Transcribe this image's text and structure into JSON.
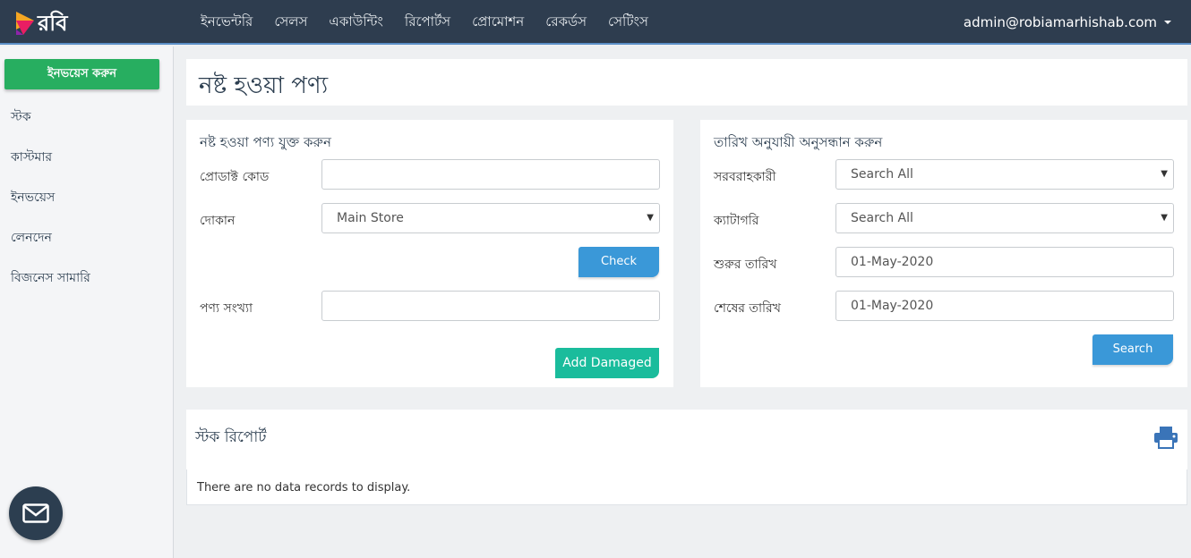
{
  "brand": {
    "name": "রবি"
  },
  "nav": {
    "items": [
      "ইনভেন্টরি",
      "সেলস",
      "একাউন্টিং",
      "রিপোর্টস",
      "প্রোমোশন",
      "রেকর্ডস",
      "সেটিংস"
    ],
    "user": "admin@robiamarhishab.com"
  },
  "sidebar": {
    "invoice_button": "ইনভয়েস করুন",
    "items": [
      "স্টক",
      "কাস্টমার",
      "ইনভয়েস",
      "লেনদেন",
      "বিজনেস সামারি"
    ]
  },
  "page": {
    "title": "নষ্ট হওয়া পণ্য"
  },
  "add_form": {
    "heading": "নষ্ট হওয়া পণ্য যুক্ত করুন",
    "product_code_label": "প্রোডাক্ট কোড",
    "product_code_value": "",
    "store_label": "দোকান",
    "store_value": "Main Store",
    "check_button": "Check",
    "quantity_label": "পণ্য সংখ্যা",
    "quantity_value": "",
    "add_button": "Add Damaged"
  },
  "search_form": {
    "heading": "তারিখ অনুযায়ী অনুসন্ধান করুন",
    "supplier_label": "সরবরাহকারী",
    "supplier_value": "Search All",
    "category_label": "ক্যাটাগরি",
    "category_value": "Search All",
    "start_date_label": "শুরুর তারিখ",
    "start_date_value": "01-May-2020",
    "end_date_label": "শেষের তারিখ",
    "end_date_value": "01-May-2020",
    "search_button": "Search"
  },
  "report": {
    "title": "স্টক রিপোর্ট",
    "empty_message": "There are no data records to display."
  },
  "colors": {
    "topbar": "#2e3d4f",
    "green": "#27ae60",
    "blue": "#3a98d8",
    "teal": "#1abc9c"
  },
  "icons": {
    "mail": "mail-icon",
    "print": "printer-icon",
    "logo": "robi-logo-icon"
  }
}
